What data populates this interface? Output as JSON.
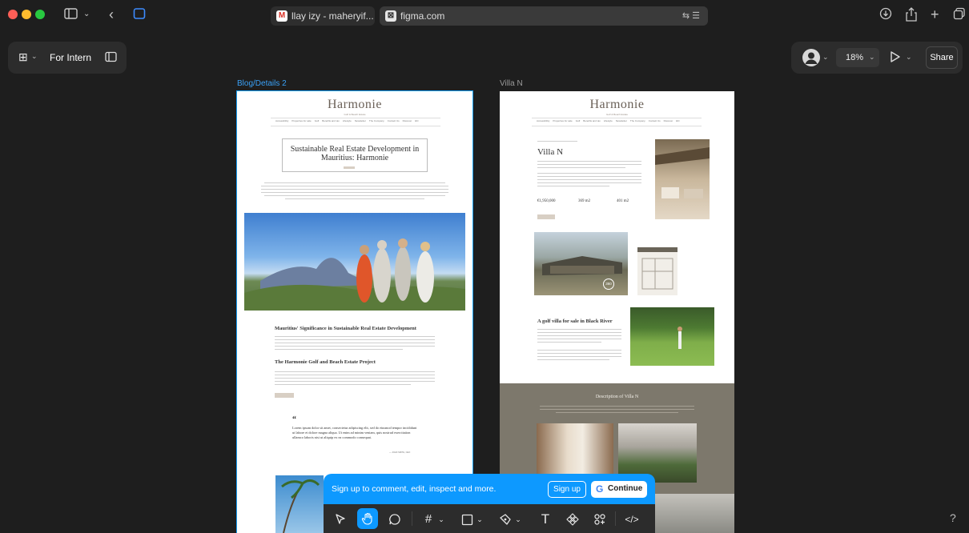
{
  "browser": {
    "tabs": [
      {
        "title": "llay izy - maheryif...",
        "favicon": "gmail-icon"
      },
      {
        "title": "figma.com",
        "favicon": "figma-tab-icon"
      }
    ]
  },
  "figma": {
    "file_name": "For Intern",
    "zoom": "18%",
    "share_label": "Share",
    "help_label": "?"
  },
  "frames": {
    "blog": {
      "label": "Blog/Details 2",
      "logo": "Harmonie",
      "tagline": "Golf & Beach Estate",
      "nav": [
        "Accessibility",
        "Properties for sale",
        "Golf",
        "Benefits and tax",
        "Lifestyle",
        "Newsletter",
        "The Company",
        "Contact Us",
        "Discover",
        "EN"
      ],
      "title": "Sustainable Real Estate Development in Mauritius: Harmonie",
      "section1": "Mauritius' Significance in Sustainable Real Estate Development",
      "section2": "The Harmonie Golf and Beach Estate Project",
      "quote_mark": "“",
      "quote": "Lorem ipsum dolor sit amet, consectetur adipiscing elit, sed do eiusmod tempor incididunt ut labore et dolore magna aliqua. Ut enim ad minim veniam, quis nostrud exercitation ullamco laboris nisi ut aliquip ex ea commodo consequat.",
      "quote_author": "— JOHN SMITH, CEO"
    },
    "villa": {
      "label": "Villa N",
      "logo": "Harmonie",
      "tagline": "Golf & Beach Estate",
      "nav": [
        "Accessibility",
        "Properties for sale",
        "Golf",
        "Benefits and tax",
        "Lifestyle",
        "Newsletter",
        "The Company",
        "Contact Us",
        "Discover",
        "EN"
      ],
      "heading": "Villa N",
      "price": "€1,950,000",
      "area1": "369 m2",
      "area2": "401 m2",
      "badge_360": "360",
      "golf_heading": "A golf villa for sale in Black River",
      "description_heading": "Description of Villa N"
    }
  },
  "signup": {
    "message": "Sign up to comment, edit, inspect and more.",
    "signup_label": "Sign up",
    "continue_label": "Continue"
  },
  "colors": {
    "accent": "#0d99ff",
    "canvas": "#1e1e1e",
    "panel": "#2c2c2c",
    "villa_band": "#7d786c",
    "selection": "#18a0fb"
  }
}
